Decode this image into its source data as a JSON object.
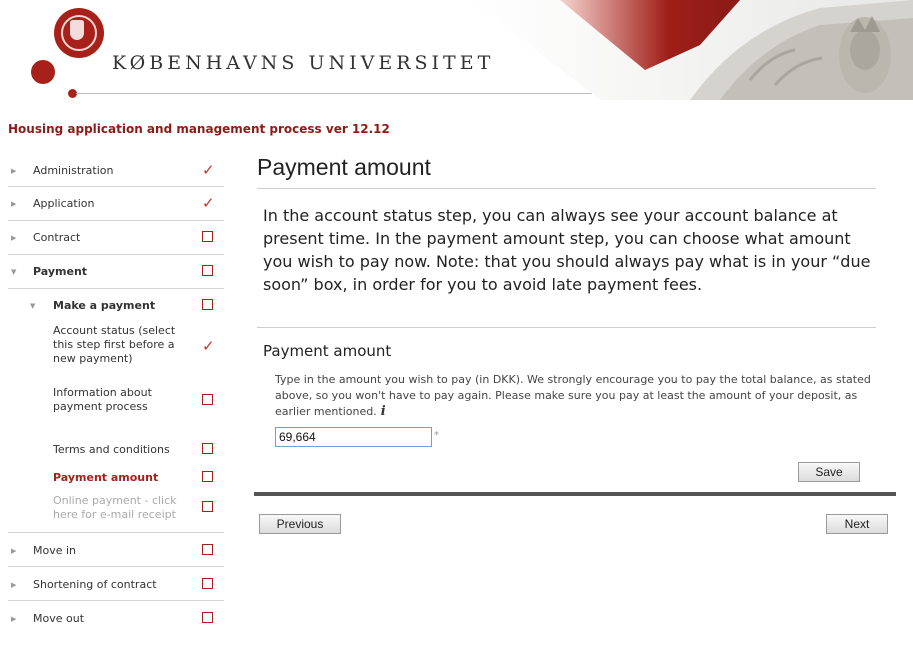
{
  "header": {
    "university_name": "KØBENHAVNS UNIVERSITET",
    "process_title": "Housing application and management process ver 12.12",
    "brand_color": "#a8201a"
  },
  "sidebar": {
    "items": [
      {
        "label": "Administration",
        "status": "done"
      },
      {
        "label": "Application",
        "status": "done"
      },
      {
        "label": "Contract",
        "status": "open"
      },
      {
        "label": "Payment",
        "status": "open",
        "expanded": true
      },
      {
        "label": "Make a payment",
        "status": "open",
        "expanded": true
      },
      {
        "label": "Account status (select this step first before a new payment)",
        "status": "done"
      },
      {
        "label": "Information about payment process",
        "status": "open"
      },
      {
        "label": "Terms and conditions",
        "status": "open"
      },
      {
        "label": "Payment amount",
        "status": "open",
        "current": true
      },
      {
        "label": "Online payment - click here for e-mail receipt",
        "status": "open",
        "disabled": true
      },
      {
        "label": "Move in",
        "status": "open"
      },
      {
        "label": "Shortening of contract",
        "status": "open"
      },
      {
        "label": "Move out",
        "status": "open"
      }
    ]
  },
  "main": {
    "title": "Payment amount",
    "intro": "In the account status step, you can always see your account balance at present time. In the payment amount step, you can choose what amount you wish to pay now. Note: that you should always pay what is in your “due soon” box, in order for you to avoid late payment fees.",
    "section_title": "Payment amount",
    "help_text": "Type in the amount you wish to pay (in DKK). We strongly encourage you to pay the total balance, as stated above, so you won't have to pay again. Please make sure you pay at least the amount of your deposit, as earlier mentioned.",
    "info_glyph": "i",
    "amount_value": "69,664",
    "required_mark": "*",
    "save_label": "Save",
    "previous_label": "Previous",
    "next_label": "Next"
  }
}
